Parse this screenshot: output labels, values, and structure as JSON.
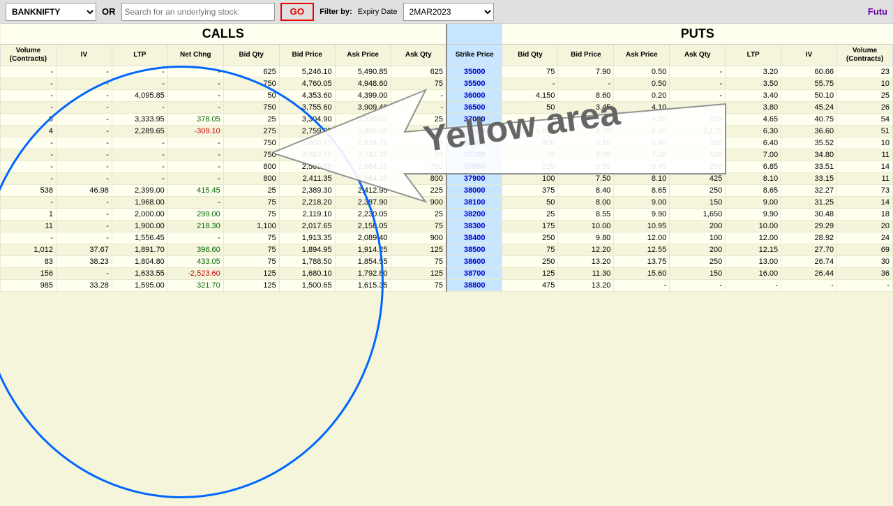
{
  "header": {
    "ticker": "BANKNIFTY",
    "or_label": "OR",
    "search_placeholder": "Search for an underlying stock:",
    "go_label": "GO",
    "filter_label": "Filter by:",
    "expiry_label": "Expiry Date",
    "expiry_value": "2MAR2023",
    "future_label": "Futu"
  },
  "columns": {
    "calls_label": "CALLS",
    "puts_label": "PUTS",
    "volume": "Volume (Contracts)",
    "iv": "IV",
    "ltp": "LTP",
    "net_chng": "Net Chng",
    "bid_qty": "Bid Qty",
    "bid_price": "Bid Price",
    "ask_price": "Ask Price",
    "ask_qty": "Ask Qty",
    "strike": "Strike Price",
    "put_bid_qty": "Bid Qty",
    "put_bid_price": "Bid Price",
    "put_ask_price": "Ask Price",
    "put_ask_qty": "Ask Qty",
    "put_ltp": "LTP",
    "put_iv": "IV",
    "put_volume": "Volume (Contracts)"
  },
  "rows": [
    {
      "vol": "-",
      "iv": "-",
      "ltp": "-",
      "net": "-",
      "bq": "625",
      "bp": "5,246.10",
      "ap": "5,490.85",
      "aq": "625",
      "strike": "35000",
      "pbq": "75",
      "pbp": "7.90",
      "pap": "0.50",
      "paq": "-",
      "pltp": "3.20",
      "piv": "60.66",
      "pvol": "23"
    },
    {
      "vol": "-",
      "iv": "-",
      "ltp": "-",
      "net": "-",
      "bq": "750",
      "bp": "4,760.05",
      "ap": "4,948.60",
      "aq": "75",
      "strike": "35500",
      "pbq": "-",
      "pbp": "-",
      "pap": "0.50",
      "paq": "-",
      "pltp": "3.50",
      "piv": "55.75",
      "pvol": "10"
    },
    {
      "vol": "-",
      "iv": "-",
      "ltp": "4,095.85",
      "net": "-",
      "bq": "50",
      "bp": "4,353.60",
      "ap": "4,399.00",
      "aq": "-",
      "strike": "36000",
      "pbq": "4,150",
      "pbp": "8.60",
      "pap": "0.20",
      "paq": "-",
      "pltp": "3.40",
      "piv": "50.10",
      "pvol": "25"
    },
    {
      "vol": "-",
      "iv": "-",
      "ltp": "-",
      "net": "-",
      "bq": "750",
      "bp": "3,755.60",
      "ap": "3,909.40",
      "aq": "-",
      "strike": "36500",
      "pbq": "50",
      "pbp": "3.45",
      "pap": "4.10",
      "paq": "-",
      "pltp": "3.80",
      "piv": "45.24",
      "pvol": "26"
    },
    {
      "vol": "6",
      "iv": "-",
      "ltp": "3,333.95",
      "net": "378.05",
      "bq": "25",
      "bp": "3,304.90",
      "ap": "3,399.00",
      "aq": "25",
      "strike": "37000",
      "pbq": "-",
      "pbp": "4.60",
      "pap": "4.65",
      "paq": "875",
      "pltp": "4.65",
      "piv": "40.75",
      "pvol": "54"
    },
    {
      "vol": "4",
      "iv": "-",
      "ltp": "2,289.65",
      "net": "-309.10",
      "bq": "275",
      "bp": "2,759.85",
      "ap": "2,899.00",
      "aq": "25",
      "strike": "37500",
      "pbq": "1,025",
      "pbp": "5.70",
      "pap": "6.30",
      "paq": "2,175",
      "pltp": "6.30",
      "piv": "36.60",
      "pvol": "51"
    },
    {
      "vol": "-",
      "iv": "-",
      "ltp": "-",
      "net": "-",
      "bq": "750",
      "bp": "2,660.05",
      "ap": "2,824.75",
      "aq": "75",
      "strike": "37600",
      "pbq": "900",
      "pbp": "6.10",
      "pap": "6.40",
      "paq": "350",
      "pltp": "6.40",
      "piv": "35.52",
      "pvol": "10"
    },
    {
      "vol": "-",
      "iv": "-",
      "ltp": "-",
      "net": "-",
      "bq": "750",
      "bp": "2,587.75",
      "ap": "2,747.75",
      "aq": "75",
      "strike": "37700",
      "pbq": "75",
      "pbp": "6.05",
      "pap": "7.00",
      "paq": "100",
      "pltp": "7.00",
      "piv": "34.80",
      "pvol": "11"
    },
    {
      "vol": "-",
      "iv": "-",
      "ltp": "-",
      "net": "-",
      "bq": "800",
      "bp": "2,509.65",
      "ap": "2,664.15",
      "aq": "750",
      "strike": "37800",
      "pbq": "225",
      "pbp": "6.55",
      "pap": "9.45",
      "paq": "250",
      "pltp": "6.85",
      "piv": "33.51",
      "pvol": "14"
    },
    {
      "vol": "-",
      "iv": "-",
      "ltp": "-",
      "net": "-",
      "bq": "800",
      "bp": "2,411.35",
      "ap": "2,564.30",
      "aq": "800",
      "strike": "37900",
      "pbq": "100",
      "pbp": "7.50",
      "pap": "8.10",
      "paq": "425",
      "pltp": "8.10",
      "piv": "33.15",
      "pvol": "11"
    },
    {
      "vol": "538",
      "iv": "46.98",
      "ltp": "2,399.00",
      "net": "415.45",
      "bq": "25",
      "bp": "2,389.30",
      "ap": "2,412.95",
      "aq": "225",
      "strike": "38000",
      "pbq": "375",
      "pbp": "8.40",
      "pap": "8.65",
      "paq": "250",
      "pltp": "8.65",
      "piv": "32.27",
      "pvol": "73"
    },
    {
      "vol": "-",
      "iv": "-",
      "ltp": "1,968.00",
      "net": "-",
      "bq": "75",
      "bp": "2,218.20",
      "ap": "2,387.90",
      "aq": "900",
      "strike": "38100",
      "pbq": "50",
      "pbp": "8.00",
      "pap": "9.00",
      "paq": "150",
      "pltp": "9.00",
      "piv": "31.25",
      "pvol": "14"
    },
    {
      "vol": "1",
      "iv": "-",
      "ltp": "2,000.00",
      "net": "299.00",
      "bq": "75",
      "bp": "2,119.10",
      "ap": "2,230.05",
      "aq": "25",
      "strike": "38200",
      "pbq": "25",
      "pbp": "8.55",
      "pap": "9.90",
      "paq": "1,650",
      "pltp": "9.90",
      "piv": "30.48",
      "pvol": "18"
    },
    {
      "vol": "11",
      "iv": "-",
      "ltp": "1,900.00",
      "net": "218.30",
      "bq": "1,100",
      "bp": "2,017.65",
      "ap": "2,158.05",
      "aq": "75",
      "strike": "38300",
      "pbq": "175",
      "pbp": "10.00",
      "pap": "10.95",
      "paq": "200",
      "pltp": "10.00",
      "piv": "29.29",
      "pvol": "20"
    },
    {
      "vol": "-",
      "iv": "-",
      "ltp": "1,556.45",
      "net": "-",
      "bq": "75",
      "bp": "1,913.35",
      "ap": "2,089.40",
      "aq": "900",
      "strike": "38400",
      "pbq": "250",
      "pbp": "9.80",
      "pap": "12.00",
      "paq": "100",
      "pltp": "12.00",
      "piv": "28.92",
      "pvol": "24"
    },
    {
      "vol": "1,012",
      "iv": "37.67",
      "ltp": "1,891.70",
      "net": "396.60",
      "bq": "75",
      "bp": "1,894.95",
      "ap": "1,914.25",
      "aq": "125",
      "strike": "38500",
      "pbq": "75",
      "pbp": "12.20",
      "pap": "12.55",
      "paq": "200",
      "pltp": "12.15",
      "piv": "27.70",
      "pvol": "69"
    },
    {
      "vol": "83",
      "iv": "38.23",
      "ltp": "1,804.80",
      "net": "433.05",
      "bq": "75",
      "bp": "1,788.50",
      "ap": "1,854.55",
      "aq": "75",
      "strike": "38600",
      "pbq": "250",
      "pbp": "13.20",
      "pap": "13.75",
      "paq": "250",
      "pltp": "13.00",
      "piv": "26.74",
      "pvol": "30"
    },
    {
      "vol": "156",
      "iv": "-",
      "ltp": "1,633.55",
      "net": "-2,523.60",
      "bq": "125",
      "bp": "1,680.10",
      "ap": "1,792.80",
      "aq": "125",
      "strike": "38700",
      "pbq": "125",
      "pbp": "11.30",
      "pap": "15.60",
      "paq": "150",
      "pltp": "16.00",
      "piv": "26.44",
      "pvol": "36"
    },
    {
      "vol": "985",
      "iv": "33.28",
      "ltp": "1,595.00",
      "net": "321.70",
      "bq": "125",
      "bp": "1,500.65",
      "ap": "1,615.35",
      "aq": "75",
      "strike": "38800",
      "pbq": "475",
      "pbp": "13.20",
      "pap": "-",
      "paq": "-",
      "pltp": "-",
      "piv": "-",
      "pvol": "-"
    }
  ],
  "annotation": {
    "label": "Yellow area"
  }
}
